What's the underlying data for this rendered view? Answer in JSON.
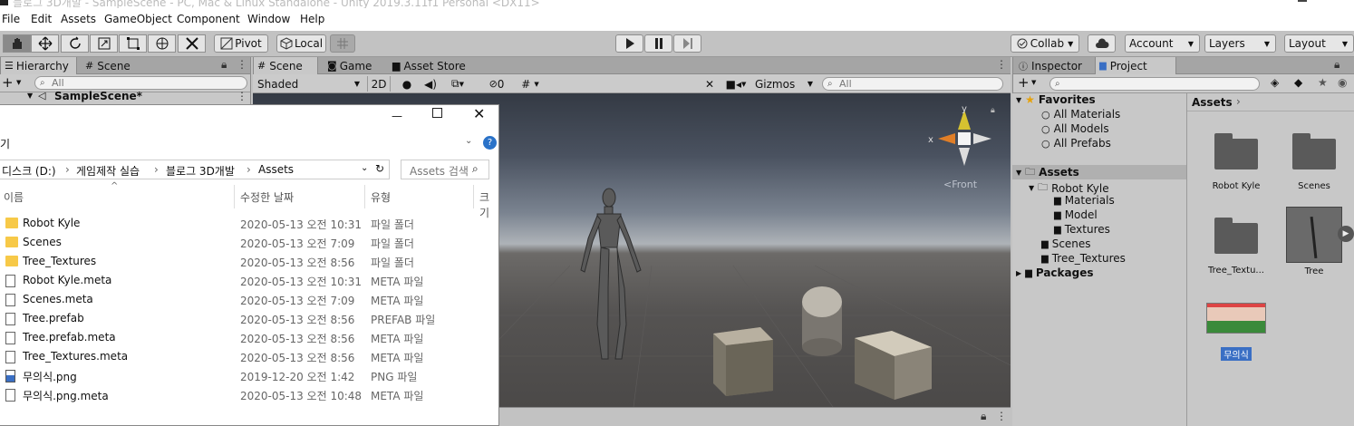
{
  "window": {
    "title": "블로그 3D개발 - SampleScene - PC, Mac & Linux Standalone - Unity 2019.3.11f1 Personal <DX11>"
  },
  "menu": [
    "File",
    "Edit",
    "Assets",
    "GameObject",
    "Component",
    "Window",
    "Help"
  ],
  "toolbar": {
    "pivot_label": "Pivot",
    "local_label": "Local",
    "collab_label": "Collab",
    "account_label": "Account",
    "layers_label": "Layers",
    "layout_label": "Layout"
  },
  "hierarchy": {
    "tabs": [
      "Hierarchy",
      "Scene"
    ],
    "search_placeholder": "All",
    "scene_name": "SampleScene*"
  },
  "scene": {
    "tabs": [
      "Scene",
      "Game",
      "Asset Store"
    ],
    "shading": "Shaded",
    "mode_2d": "2D",
    "hidden_count": "0",
    "gizmos_label": "Gizmos",
    "search_placeholder": "All",
    "gizmo_x": "x",
    "gizmo_y": "y",
    "gizmo_front": "Front"
  },
  "project": {
    "tabs": [
      "Inspector",
      "Project"
    ],
    "favorites_label": "Favorites",
    "favorites": [
      "All Materials",
      "All Models",
      "All Prefabs"
    ],
    "assets_label": "Assets",
    "robot_kyle": "Robot Kyle",
    "robot_kyle_children": [
      "Materials",
      "Model",
      "Textures"
    ],
    "scenes": "Scenes",
    "tree_textures": "Tree_Textures",
    "packages": "Packages",
    "breadcrumb": "Assets",
    "grid": [
      "Robot Kyle",
      "Scenes",
      "Tree_Textu...",
      "Tree",
      "무의식"
    ]
  },
  "explorer": {
    "title_partial": "기",
    "path": [
      "디스크 (D:)",
      "게임제작 실습",
      "블로그 3D개발",
      "Assets"
    ],
    "search_placeholder": "Assets 검색",
    "columns": [
      "이름",
      "수정한 날짜",
      "유형",
      "크기"
    ],
    "rows": [
      {
        "name": "Robot Kyle",
        "date": "2020-05-13 오전 10:31",
        "type": "파일 폴더",
        "kind": "folder"
      },
      {
        "name": "Scenes",
        "date": "2020-05-13 오전 7:09",
        "type": "파일 폴더",
        "kind": "folder"
      },
      {
        "name": "Tree_Textures",
        "date": "2020-05-13 오전 8:56",
        "type": "파일 폴더",
        "kind": "folder"
      },
      {
        "name": "Robot Kyle.meta",
        "date": "2020-05-13 오전 10:31",
        "type": "META 파일",
        "kind": "file"
      },
      {
        "name": "Scenes.meta",
        "date": "2020-05-13 오전 7:09",
        "type": "META 파일",
        "kind": "file"
      },
      {
        "name": "Tree.prefab",
        "date": "2020-05-13 오전 8:56",
        "type": "PREFAB 파일",
        "kind": "file"
      },
      {
        "name": "Tree.prefab.meta",
        "date": "2020-05-13 오전 8:56",
        "type": "META 파일",
        "kind": "file"
      },
      {
        "name": "Tree_Textures.meta",
        "date": "2020-05-13 오전 8:56",
        "type": "META 파일",
        "kind": "file"
      },
      {
        "name": "무의식.png",
        "date": "2019-12-20 오전 1:42",
        "type": "PNG 파일",
        "kind": "png"
      },
      {
        "name": "무의식.png.meta",
        "date": "2020-05-13 오전 10:48",
        "type": "META 파일",
        "kind": "file"
      }
    ]
  }
}
